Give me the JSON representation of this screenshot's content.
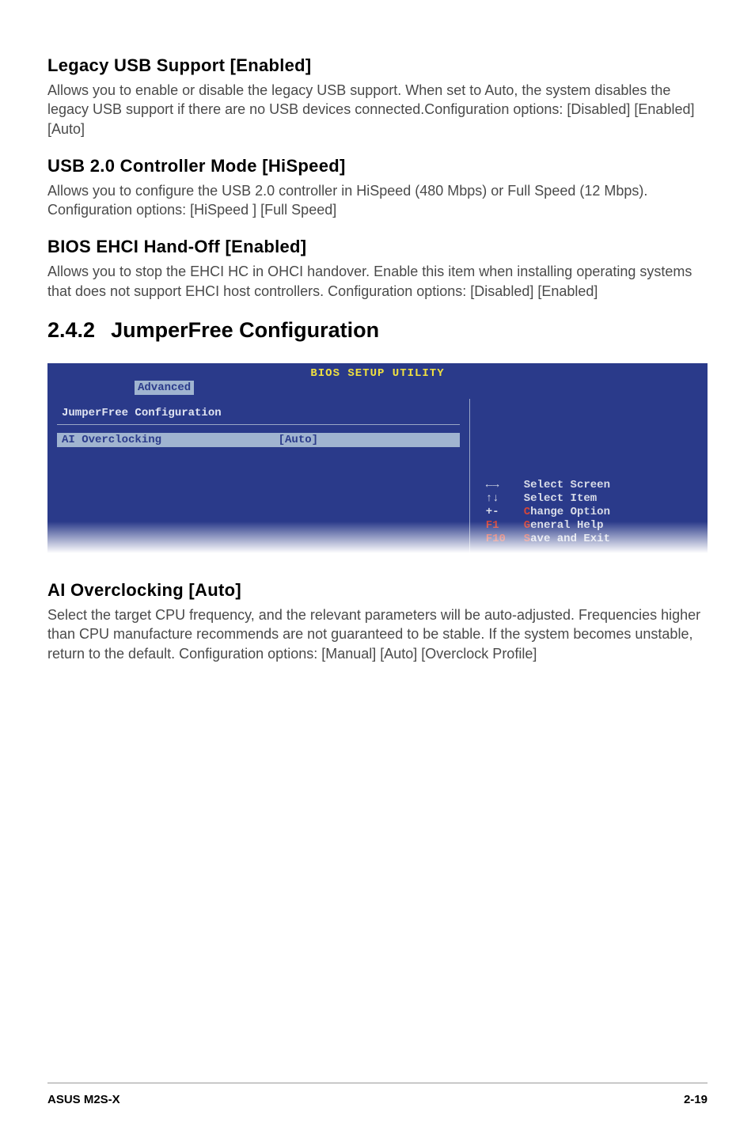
{
  "sections": {
    "legacy_usb": {
      "heading": "Legacy USB Support [Enabled]",
      "body": "Allows you to enable or disable the legacy USB support. When set to Auto, the system disables the legacy USB support if there are no USB devices connected.Configuration options: [Disabled] [Enabled] [Auto]"
    },
    "usb20_mode": {
      "heading": "USB 2.0 Controller Mode [HiSpeed]",
      "body": "Allows you to configure the USB 2.0 controller in HiSpeed (480 Mbps) or Full Speed (12 Mbps). Configuration options: [HiSpeed ] [Full Speed]"
    },
    "bios_ehci": {
      "heading": "BIOS EHCI Hand-Off [Enabled]",
      "body": "Allows you to stop the EHCI HC in OHCI handover. Enable this item when installing operating systems that does not support EHCI host controllers. Configuration options: [Disabled] [Enabled]"
    },
    "jumperfree": {
      "number": "2.4.2",
      "title": "JumperFree Configuration"
    },
    "ai_overclocking": {
      "heading": "AI Overclocking [Auto]",
      "body": "Select the target CPU frequency, and the relevant parameters will be auto-adjusted. Frequencies higher than CPU manufacture recommends are not guaranteed to be stable. If the system becomes unstable, return to the default. Configuration options: [Manual] [Auto] [Overclock Profile]"
    }
  },
  "bios": {
    "title": "BIOS SETUP UTILITY",
    "tab": "Advanced",
    "panel_title": "JumperFree Configuration",
    "row": {
      "label": "AI Overclocking",
      "value": "[Auto]"
    },
    "help": [
      {
        "key": "←→",
        "key_red": false,
        "desc": "Select Screen",
        "accel": ""
      },
      {
        "key": "↑↓",
        "key_red": false,
        "desc": "Select Item",
        "accel": ""
      },
      {
        "key": "+-",
        "key_red": false,
        "desc": "hange Option",
        "accel": "C"
      },
      {
        "key": "F1",
        "key_red": true,
        "desc": "eneral Help",
        "accel": "G"
      },
      {
        "key": "F10",
        "key_red": true,
        "desc": "ave and Exit",
        "accel": "S"
      }
    ]
  },
  "footer": {
    "left": "ASUS M2S-X",
    "right": "2-19"
  }
}
